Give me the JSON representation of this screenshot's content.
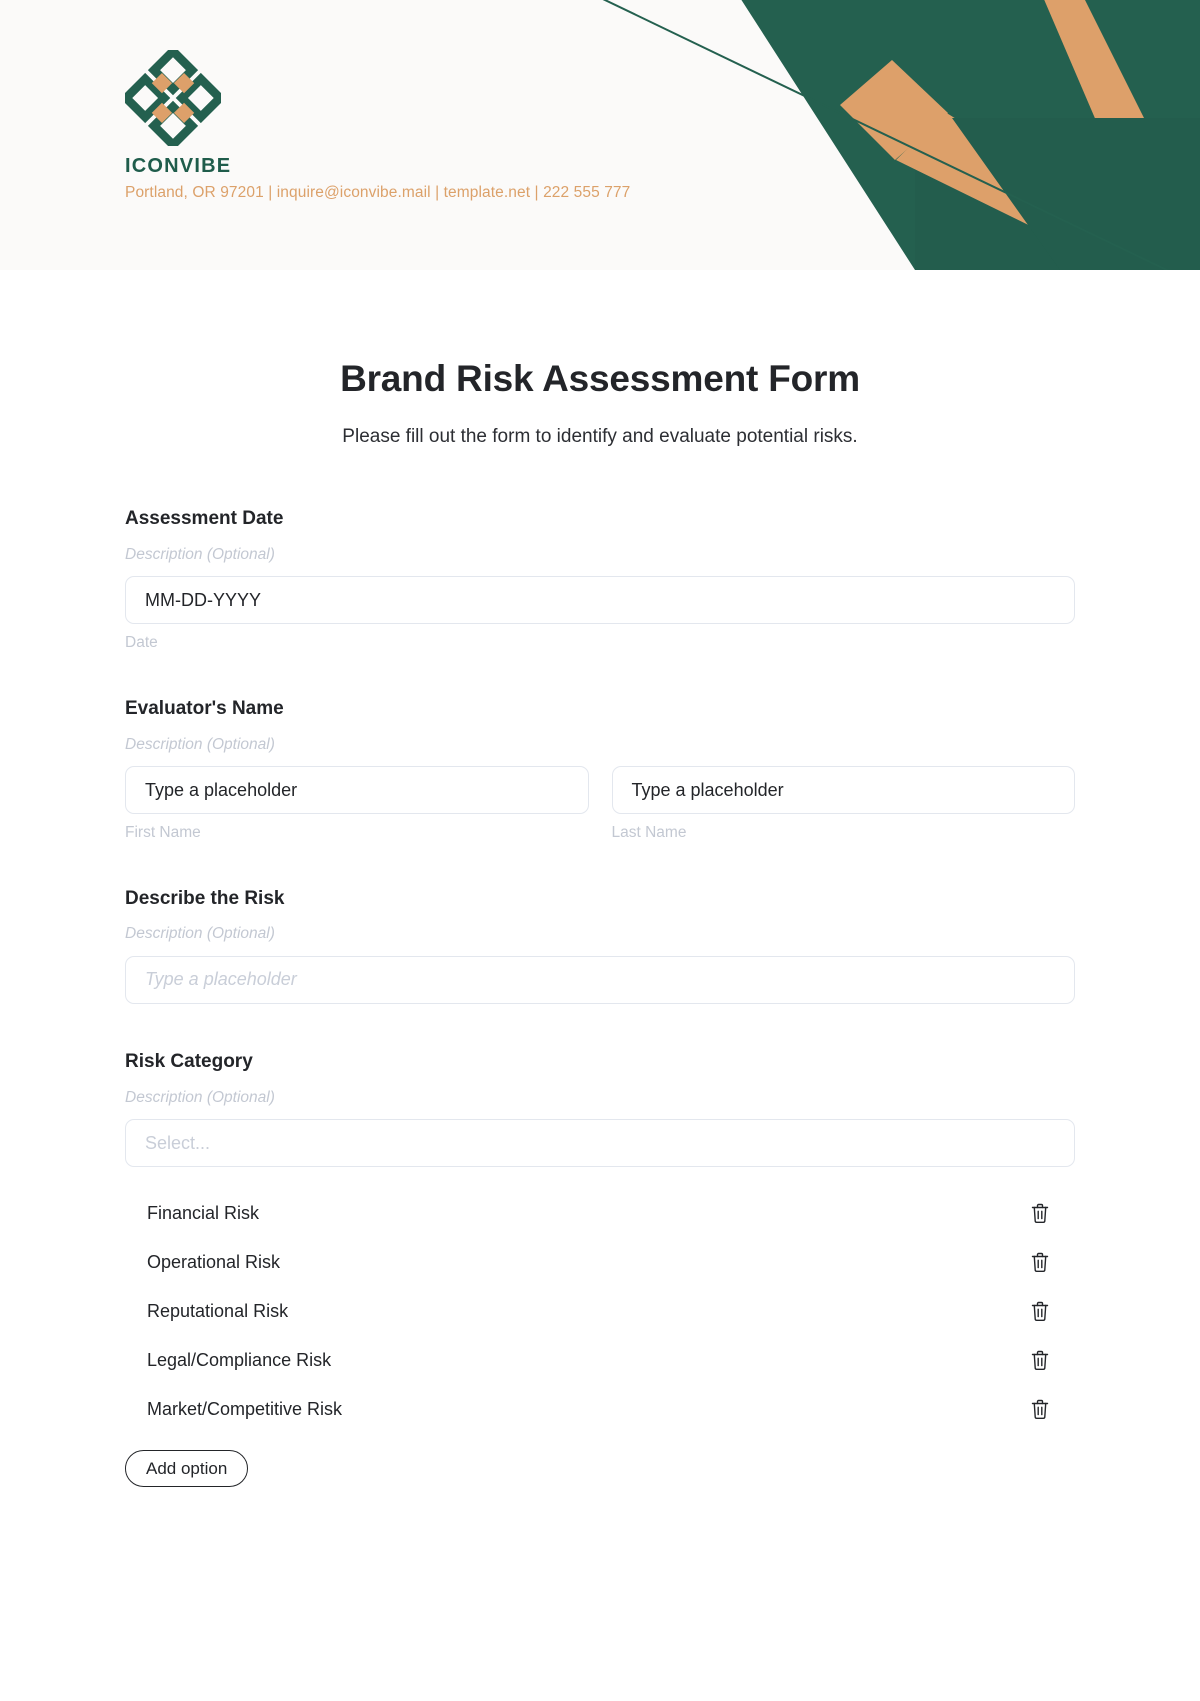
{
  "brand": {
    "name": "ICONVIBE",
    "contact": "Portland, OR 97201 | inquire@iconvibe.mail | template.net | 222 555 777",
    "colors": {
      "green": "#24604f",
      "green_dark": "#1f5c4b",
      "orange": "#dda06a",
      "header_bg": "#fbfaf9"
    }
  },
  "page": {
    "title": "Brand Risk Assessment Form",
    "subtitle": "Please fill out the form to identify and evaluate potential risks."
  },
  "fields": {
    "assessment_date": {
      "label": "Assessment Date",
      "description": "Description (Optional)",
      "value": "MM-DD-YYYY",
      "sub_label": "Date"
    },
    "evaluator_name": {
      "label": "Evaluator's Name",
      "description": "Description (Optional)",
      "first": {
        "value": "Type a placeholder",
        "sub_label": "First Name"
      },
      "last": {
        "value": "Type a placeholder",
        "sub_label": "Last Name"
      }
    },
    "describe_risk": {
      "label": "Describe the Risk",
      "description": "Description (Optional)",
      "placeholder": "Type a placeholder"
    },
    "risk_category": {
      "label": "Risk Category",
      "description": "Description (Optional)",
      "placeholder": "Select...",
      "options": [
        {
          "label": "Financial Risk",
          "delete_icon": "trash-icon"
        },
        {
          "label": "Operational Risk",
          "delete_icon": "trash-icon"
        },
        {
          "label": "Reputational Risk",
          "delete_icon": "trash-icon"
        },
        {
          "label": "Legal/Compliance Risk",
          "delete_icon": "trash-icon"
        },
        {
          "label": "Market/Competitive Risk",
          "delete_icon": "trash-icon"
        }
      ],
      "add_option_label": "Add option"
    }
  }
}
